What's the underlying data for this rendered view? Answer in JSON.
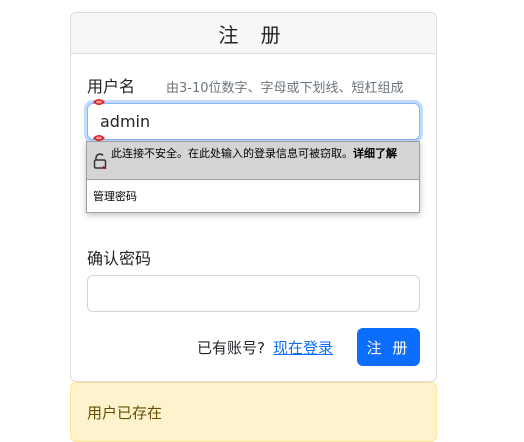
{
  "form": {
    "title": "注 册",
    "username_label": "用户名",
    "username_hint": "由3-10位数字、字母或下划线、短杠组成",
    "username_value": "admin",
    "password_label": "",
    "confirm_label": "确认密码",
    "confirm_value": "",
    "have_account_text": "已有账号?",
    "login_link": "现在登录",
    "register_button": "注 册"
  },
  "autofill_popup": {
    "warning_text": "此连接不安全。在此处输入的登录信息可被窃取。",
    "warning_more": "详细了解",
    "suggestion": "管理密码",
    "lock_icon": "broken-lock-icon"
  },
  "alert": {
    "message": "用户已存在",
    "color": "#fff3cd"
  },
  "colors": {
    "primary": "#0d6efd",
    "focus_border": "#86b7fe"
  }
}
